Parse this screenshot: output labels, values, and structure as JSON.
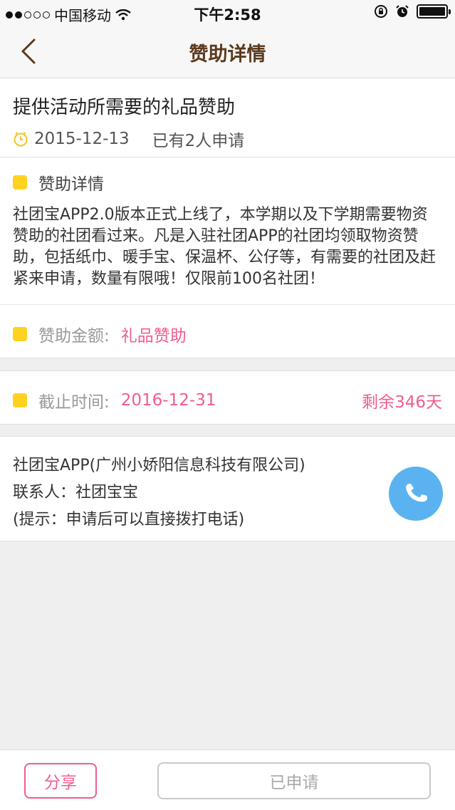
{
  "status_bar": {
    "carrier": "中国移动",
    "time": "下午2:58",
    "signal_bars_filled": 2,
    "signal_bars_total": 5
  },
  "nav": {
    "title": "赞助详情",
    "back_icon": "chevron-left-icon"
  },
  "sponsorship": {
    "title": "提供活动所需要的礼品赞助",
    "date": "2015-12-13",
    "applicants": "已有2人申请",
    "detail_header": "赞助详情",
    "description": "社团宝APP2.0版本正式上线了，本学期以及下学期需要物资赞助的社团看过来。凡是入驻社团APP的社团均领取物资赞助，包括纸巾、暖手宝、保温杯、公仔等，有需要的社团及赶紧来申请，数量有限哦！仅限前100名社团！",
    "amount_label": "赞助金额:",
    "amount_value": "礼品赞助",
    "deadline_label": "截止时间:",
    "deadline_value": "2016-12-31",
    "remaining": "剩余346天"
  },
  "contact": {
    "company": "社团宝APP(广州小娇阳信息科技有限公司)",
    "person": "联系人：社团宝宝",
    "tip": "(提示：申请后可以直接拨打电话)",
    "phone_icon": "phone-icon"
  },
  "bottom": {
    "share_label": "分享",
    "applied_label": "已申请"
  },
  "colors": {
    "accent_pink": "#ef5e8d",
    "bullet_yellow": "#ffd21f",
    "phone_blue": "#5ab3f0",
    "title_brown": "#5b3a1e"
  }
}
